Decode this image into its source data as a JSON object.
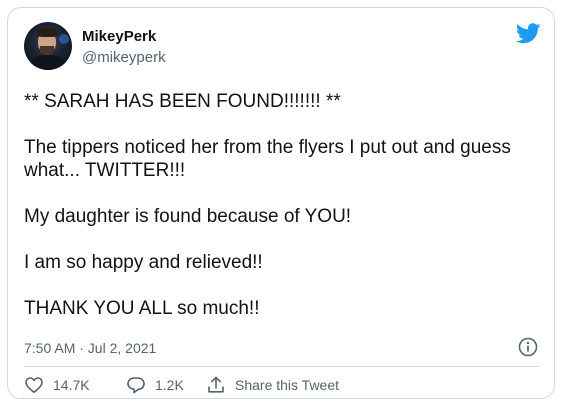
{
  "author": {
    "name": "MikeyPerk",
    "handle": "@mikeyperk"
  },
  "tweet": {
    "paragraphs": [
      "** SARAH HAS BEEN FOUND!!!!!!! **",
      "The tippers noticed her from the flyers I put out and guess what... TWITTER!!!",
      "My daughter is found because of YOU!",
      "I am so happy and relieved!!",
      "THANK YOU ALL so much!!"
    ],
    "timestamp": "7:50 AM · Jul 2, 2021"
  },
  "actions": {
    "likes": "14.7K",
    "replies": "1.2K",
    "share_label": "Share this Tweet"
  },
  "icons": {
    "brand": "twitter-bird-icon",
    "info": "info-icon",
    "like": "heart-icon",
    "reply": "reply-bubble-icon",
    "share": "share-icon"
  },
  "colors": {
    "brand": "#1d9bf0",
    "text": "#0f1419",
    "secondary": "#536471",
    "border": "#cfd9de"
  }
}
